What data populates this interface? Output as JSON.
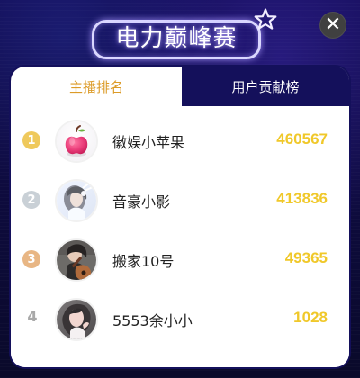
{
  "header": {
    "title": "电力巅峰赛",
    "close_icon": "close-icon",
    "star_icon": "star-icon"
  },
  "tabs": [
    {
      "label": "主播排名",
      "active": true
    },
    {
      "label": "用户贡献榜",
      "active": false
    }
  ],
  "rankings": [
    {
      "rank": "1",
      "name": "徽娱小苹果",
      "score": "460567",
      "avatar": "apple-avatar"
    },
    {
      "rank": "2",
      "name": "音豪小影",
      "score": "413836",
      "avatar": "girl-avatar"
    },
    {
      "rank": "3",
      "name": "搬家10号",
      "score": "49365",
      "avatar": "guitar-avatar"
    },
    {
      "rank": "4",
      "name": "5553余小小",
      "score": "1028",
      "avatar": "woman-avatar"
    }
  ],
  "colors": {
    "background": "#0d0a38",
    "tab_active_text": "#dc9b28",
    "score": "#f0c82a",
    "rank_gold": "#efc95c",
    "rank_silver": "#c9d0d6",
    "rank_bronze": "#e8b684"
  }
}
